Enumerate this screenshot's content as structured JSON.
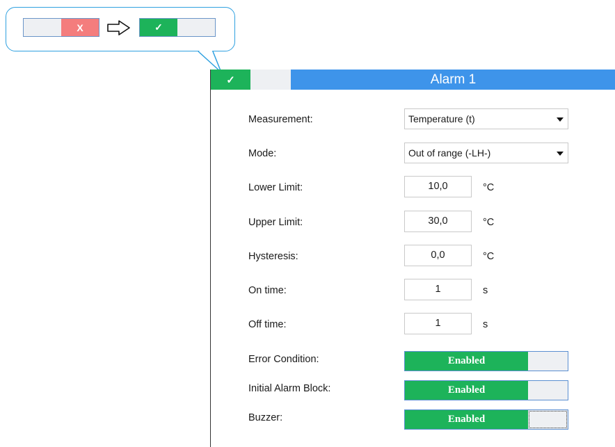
{
  "callout": {
    "off_toggle": {
      "off_label": "",
      "on_label": "X"
    },
    "on_toggle": {
      "on_label": "✓",
      "off_label": ""
    }
  },
  "panel": {
    "title": "Alarm 1",
    "header_toggle": {
      "on_label": "✓"
    }
  },
  "fields": {
    "measurement": {
      "label": "Measurement:",
      "value": "Temperature (t)"
    },
    "mode": {
      "label": "Mode:",
      "value": "Out of range (-LH-)"
    },
    "lower_limit": {
      "label": "Lower Limit:",
      "value": "10,0",
      "unit": "°C"
    },
    "upper_limit": {
      "label": "Upper Limit:",
      "value": "30,0",
      "unit": "°C"
    },
    "hysteresis": {
      "label": "Hysteresis:",
      "value": "0,0",
      "unit": "°C"
    },
    "on_time": {
      "label": "On time:",
      "value": "1",
      "unit": "s"
    },
    "off_time": {
      "label": "Off time:",
      "value": "1",
      "unit": "s"
    },
    "error_condition": {
      "label": "Error Condition:",
      "state": "Enabled"
    },
    "initial_alarm_block": {
      "label": "Initial Alarm Block:",
      "state": "Enabled"
    },
    "buzzer": {
      "label": "Buzzer:",
      "state": "Enabled"
    }
  },
  "colors": {
    "accent_blue": "#3e94ea",
    "enabled_green": "#1db35a",
    "disabled_red": "#f47d7d",
    "callout_border": "#2ea0e0"
  },
  "icons": [
    "check-icon",
    "x-icon",
    "right-arrow-icon",
    "dropdown-caret-icon"
  ]
}
